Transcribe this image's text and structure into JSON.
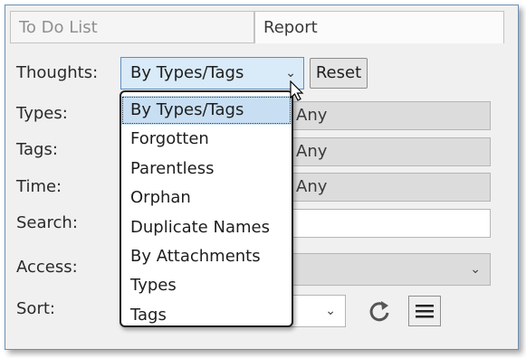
{
  "tabs": [
    {
      "label": "To Do List",
      "active": false
    },
    {
      "label": "Report",
      "active": true
    }
  ],
  "form": {
    "thoughts_label": "Thoughts:",
    "thoughts_value": "By Types/Tags",
    "reset_label": "Reset",
    "types_label": "Types:",
    "types_value": "Any",
    "tags_label": "Tags:",
    "tags_value": "Any",
    "time_label": "Time:",
    "time_value": "Any",
    "search_label": "Search:",
    "search_value": "",
    "access_label": "Access:",
    "access_value": "",
    "sort_label": "Sort:",
    "sort_value": ""
  },
  "dropdown": {
    "selected_index": 0,
    "options": [
      "By Types/Tags",
      "Forgotten",
      "Parentless",
      "Orphan",
      "Duplicate Names",
      "By Attachments",
      "Types",
      "Tags"
    ]
  },
  "icons": {
    "combo_chevron": "chevron-down-icon",
    "refresh": "refresh-icon",
    "menu": "hamburger-menu-icon",
    "cursor": "mouse-pointer-icon"
  },
  "colors": {
    "combo_bg": "#d9eaf8",
    "combo_border": "#5b8fc4",
    "selected_option": "#c8dff3",
    "panel_bg": "#f0f0f0"
  }
}
